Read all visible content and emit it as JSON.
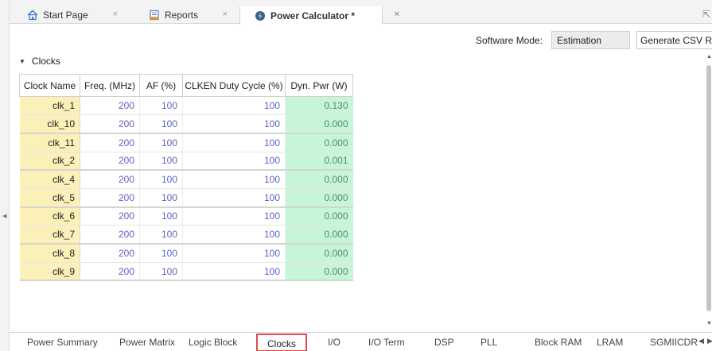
{
  "tabs": [
    {
      "label": "Start Page",
      "icon": "home-icon",
      "close": "×"
    },
    {
      "label": "Reports",
      "icon": "report-icon",
      "close": "×"
    },
    {
      "label": "Power Calculator *",
      "icon": "power-calculator-icon",
      "close": "×"
    }
  ],
  "toolbar": {
    "software_mode_label": "Software Mode:",
    "software_mode_value": "Estimation",
    "csv_button": "Generate CSV Report"
  },
  "section": {
    "title": "Clocks"
  },
  "table": {
    "columns": [
      "Clock Name",
      "Freq. (MHz)",
      "AF (%)",
      "CLKEN Duty Cycle (%)",
      "Dyn. Pwr (W)"
    ],
    "rows": [
      [
        "clk_1",
        "200",
        "100",
        "100",
        "0.130"
      ],
      [
        "clk_10",
        "200",
        "100",
        "100",
        "0.000"
      ],
      [
        "clk_11",
        "200",
        "100",
        "100",
        "0.000"
      ],
      [
        "clk_2",
        "200",
        "100",
        "100",
        "0.001"
      ],
      [
        "clk_4",
        "200",
        "100",
        "100",
        "0.000"
      ],
      [
        "clk_5",
        "200",
        "100",
        "100",
        "0.000"
      ],
      [
        "clk_6",
        "200",
        "100",
        "100",
        "0.000"
      ],
      [
        "clk_7",
        "200",
        "100",
        "100",
        "0.000"
      ],
      [
        "clk_8",
        "200",
        "100",
        "100",
        "0.000"
      ],
      [
        "clk_9",
        "200",
        "100",
        "100",
        "0.000"
      ]
    ]
  },
  "bottom_tabs": [
    "Power Summary",
    "Power Matrix",
    "Logic Block",
    "Clocks",
    "I/O",
    "I/O Term",
    "DSP",
    "PLL",
    "Block RAM",
    "LRAM",
    "SGMIICDR"
  ],
  "active_bottom_tab": "Clocks",
  "colors": {
    "name_cell": "#fbf0b8",
    "power_cell": "#c6f5d7",
    "value_text": "#5b62c7",
    "active_tab_border": "#e04a4a"
  }
}
